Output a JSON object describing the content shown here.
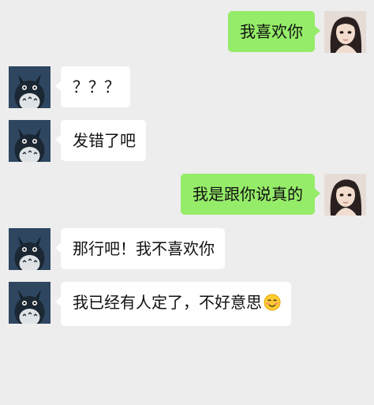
{
  "colors": {
    "background": "#ededed",
    "bubble_self": "#95ec69",
    "bubble_other": "#ffffff"
  },
  "messages": [
    {
      "sender": "self",
      "text": "我喜欢你",
      "avatar": "girl-avatar"
    },
    {
      "sender": "other",
      "text": "？？？",
      "avatar": "totoro-avatar"
    },
    {
      "sender": "other",
      "text": "发错了吧",
      "avatar": "totoro-avatar"
    },
    {
      "sender": "self",
      "text": "我是跟你说真的",
      "avatar": "girl-avatar"
    },
    {
      "sender": "other",
      "text": "那行吧！我不喜欢你",
      "avatar": "totoro-avatar"
    },
    {
      "sender": "other",
      "text": "我已经有人定了，不好意思",
      "avatar": "totoro-avatar",
      "emoji": "blush-smile-emoji"
    }
  ]
}
